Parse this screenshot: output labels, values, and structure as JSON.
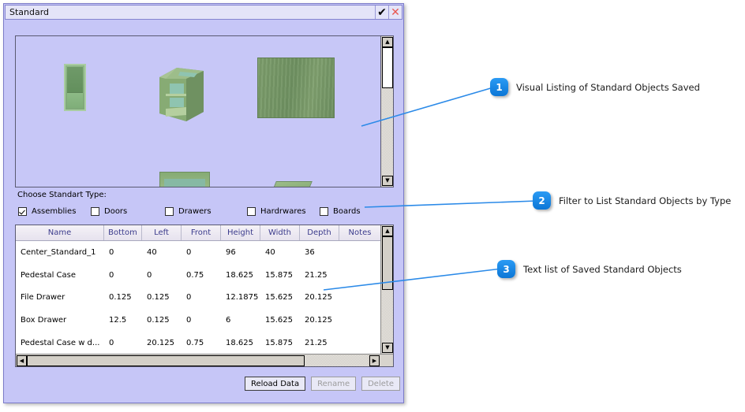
{
  "window": {
    "title": "Standard",
    "ok_icon": "check-icon",
    "ok_glyph": "✔",
    "close_icon": "close-icon",
    "close_glyph": "✕"
  },
  "viewport": {
    "name": "standard-objects-3d-preview",
    "background_color": "#c7c7f7",
    "objects": [
      {
        "name": "tall-panel-assembly"
      },
      {
        "name": "open-box-case"
      },
      {
        "name": "flat-board"
      },
      {
        "name": "partial-case-bottom"
      },
      {
        "name": "partial-board-bottom"
      }
    ],
    "scrollbar": {
      "up_glyph": "▲",
      "down_glyph": "▼"
    }
  },
  "filter": {
    "label": "Choose Standart Type:",
    "options": [
      {
        "label": "Assemblies",
        "checked": true
      },
      {
        "label": "Doors",
        "checked": false
      },
      {
        "label": "Drawers",
        "checked": false
      },
      {
        "label": "Hardrwares",
        "checked": false
      },
      {
        "label": "Boards",
        "checked": false
      }
    ]
  },
  "table": {
    "columns": [
      "Name",
      "Bottom",
      "Left",
      "Front",
      "Height",
      "Width",
      "Depth",
      "Notes"
    ],
    "rows": [
      {
        "Name": "Center_Standard_1",
        "Bottom": "0",
        "Left": "40",
        "Front": "0",
        "Height": "96",
        "Width": "40",
        "Depth": "36",
        "Notes": ""
      },
      {
        "Name": "Pedestal Case",
        "Bottom": "0",
        "Left": "0",
        "Front": "0.75",
        "Height": "18.625",
        "Width": "15.875",
        "Depth": "21.25",
        "Notes": ""
      },
      {
        "Name": "File Drawer",
        "Bottom": "0.125",
        "Left": "0.125",
        "Front": "0",
        "Height": "12.1875",
        "Width": "15.625",
        "Depth": "20.125",
        "Notes": ""
      },
      {
        "Name": "Box Drawer",
        "Bottom": "12.5",
        "Left": "0.125",
        "Front": "0",
        "Height": "6",
        "Width": "15.625",
        "Depth": "20.125",
        "Notes": ""
      },
      {
        "Name": "Pedestal Case w d...",
        "Bottom": "0",
        "Left": "20.125",
        "Front": "0.75",
        "Height": "18.625",
        "Width": "15.875",
        "Depth": "21.25",
        "Notes": ""
      }
    ],
    "scrollbar": {
      "up_glyph": "▲",
      "down_glyph": "▼",
      "left_glyph": "◀",
      "right_glyph": "▶"
    }
  },
  "buttons": [
    {
      "label": "Reload Data",
      "disabled": false
    },
    {
      "label": "Rename",
      "disabled": true
    },
    {
      "label": "Delete",
      "disabled": true
    }
  ],
  "callouts": [
    {
      "number": "1",
      "text": "Visual Listing of Standard Objects Saved"
    },
    {
      "number": "2",
      "text": "Filter to List Standard Objects by Type"
    },
    {
      "number": "3",
      "text": "Text list of Saved Standard Objects"
    }
  ],
  "colors": {
    "accent": "#1a8cf0",
    "dialog_bg": "#c6c6f7",
    "header_text": "#3b3b8c"
  }
}
